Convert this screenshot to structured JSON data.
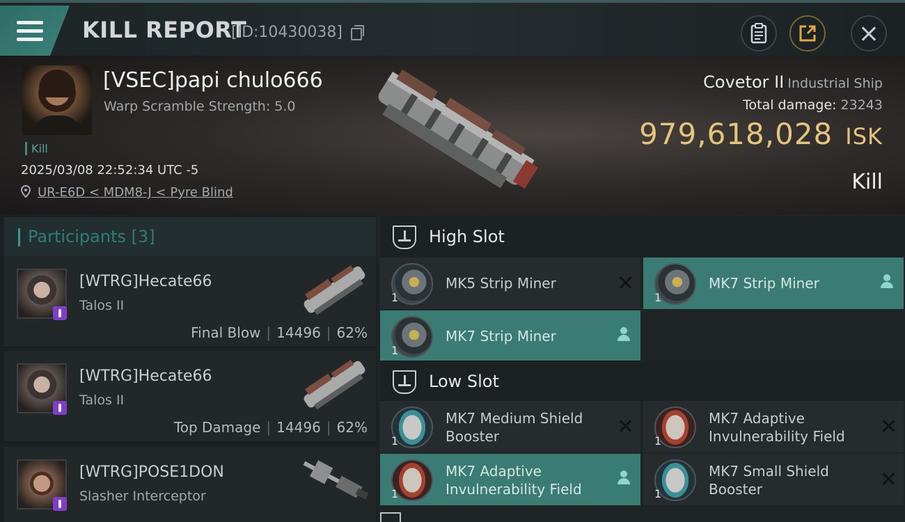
{
  "header": {
    "title": "KILL REPORT",
    "report_id": "[ID:10430038]"
  },
  "victim": {
    "name": "[VSEC]papi chulo666",
    "warp_scramble": "Warp Scramble Strength: 5.0",
    "kill_tag": "Kill",
    "datetime": "2025/03/08 22:52:34 UTC -5",
    "location": "UR-E6D < MDM8-J < Pyre Blind",
    "ship_name": "Covetor II",
    "ship_class": "Industrial Ship",
    "total_damage_label": "Total damage:",
    "total_damage": "23243",
    "isk_value": "979,618,028",
    "isk_unit": "ISK",
    "result": "Kill"
  },
  "participants": {
    "header": "Participants [3]",
    "list": [
      {
        "name": "[WTRG]Hecate66",
        "ship": "Talos II",
        "role": "Final Blow",
        "damage": "14496",
        "percent": "62%"
      },
      {
        "name": "[WTRG]Hecate66",
        "ship": "Talos II",
        "role": "Top Damage",
        "damage": "14496",
        "percent": "62%"
      },
      {
        "name": "[WTRG]POSE1DON",
        "ship": "Slasher Interceptor"
      }
    ]
  },
  "fitting": {
    "high_slot": {
      "label": "High Slot",
      "modules": [
        {
          "name": "MK5 Strip Miner",
          "qty": "1",
          "status": "destroyed",
          "icon": "strip-miner-icon"
        },
        {
          "name": "MK7 Strip Miner",
          "qty": "1",
          "status": "dropped",
          "icon": "strip-miner-icon"
        },
        {
          "name": "MK7 Strip Miner",
          "qty": "1",
          "status": "dropped",
          "icon": "strip-miner-icon"
        }
      ]
    },
    "low_slot": {
      "label": "Low Slot",
      "modules": [
        {
          "name": "MK7 Medium Shield Booster",
          "qty": "1",
          "status": "destroyed",
          "icon": "shield-booster-icon"
        },
        {
          "name": "MK7 Adaptive Invulnerability Field",
          "qty": "1",
          "status": "destroyed",
          "icon": "invulnerability-field-icon"
        },
        {
          "name": "MK7 Adaptive Invulnerability Field",
          "qty": "1",
          "status": "dropped",
          "icon": "invulnerability-field-icon"
        },
        {
          "name": "MK7 Small Shield Booster",
          "qty": "1",
          "status": "destroyed",
          "icon": "shield-booster-icon"
        }
      ]
    }
  },
  "colors": {
    "accent_teal": "#3b827a",
    "isk_gold": "#e6c47b",
    "dropped_bg": "#3a7b73"
  }
}
